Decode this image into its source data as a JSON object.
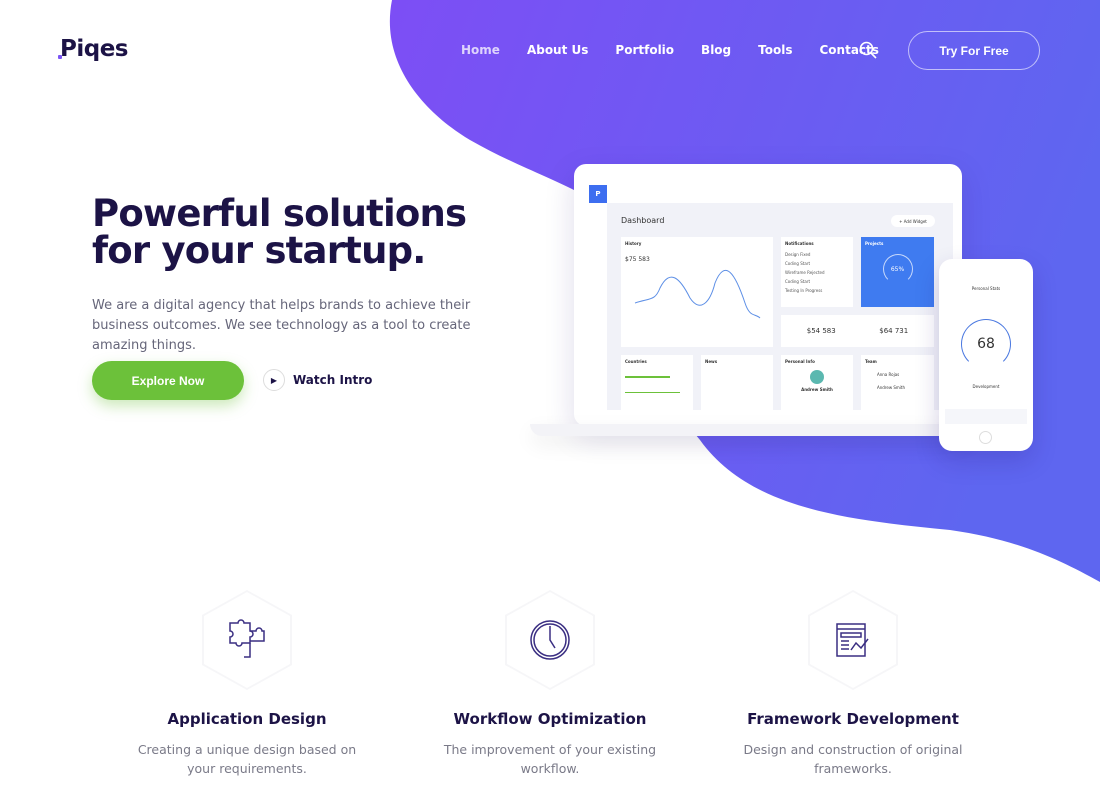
{
  "brand": {
    "name": "Piqes",
    "accent": "#7b55f5",
    "dark": "#1c1346",
    "green": "#6cc13a"
  },
  "nav": {
    "items": [
      "Home",
      "About Us",
      "Portfolio",
      "Blog",
      "Tools",
      "Contacts"
    ],
    "active": "Home",
    "cta": "Try For Free",
    "search_icon": "search-icon"
  },
  "hero": {
    "title_line1": "Powerful solutions",
    "title_line2": "for your startup.",
    "lead": "We are a digital agency that helps brands to achieve their business outcomes. We see technology as a tool to create amazing things.",
    "primary": "Explore Now",
    "secondary": "Watch Intro"
  },
  "dashboard": {
    "logo": "P",
    "title": "Dashboard",
    "add": "+ Add Widget",
    "history": "History",
    "balance": "$75 583",
    "notifications": "Notifications",
    "notif_items": [
      "Design Fixed",
      "Coding Start",
      "Wireframe Rejected",
      "Coding Start",
      "Testing In Progress"
    ],
    "projects": "Projects",
    "projects_pct": "65%",
    "stat1": "$54 583",
    "stat2": "$64 731",
    "countries": "Countries",
    "news": "News",
    "personal": "Personal Info",
    "person": "Andrew Smith",
    "team": "Team",
    "team_members": [
      "Anna Rojas",
      "Andrew Smith"
    ]
  },
  "phone": {
    "title": "Personal Stats",
    "value": "68",
    "label": "Development"
  },
  "features": [
    {
      "title": "Application Design",
      "text": "Creating a unique design based on your requirements.",
      "icon": "puzzle-icon"
    },
    {
      "title": "Workflow Optimization",
      "text": "The improvement of your existing workflow.",
      "icon": "clock-icon"
    },
    {
      "title": "Framework Development",
      "text": "Design and construction of original frameworks.",
      "icon": "browser-chart-icon"
    }
  ]
}
